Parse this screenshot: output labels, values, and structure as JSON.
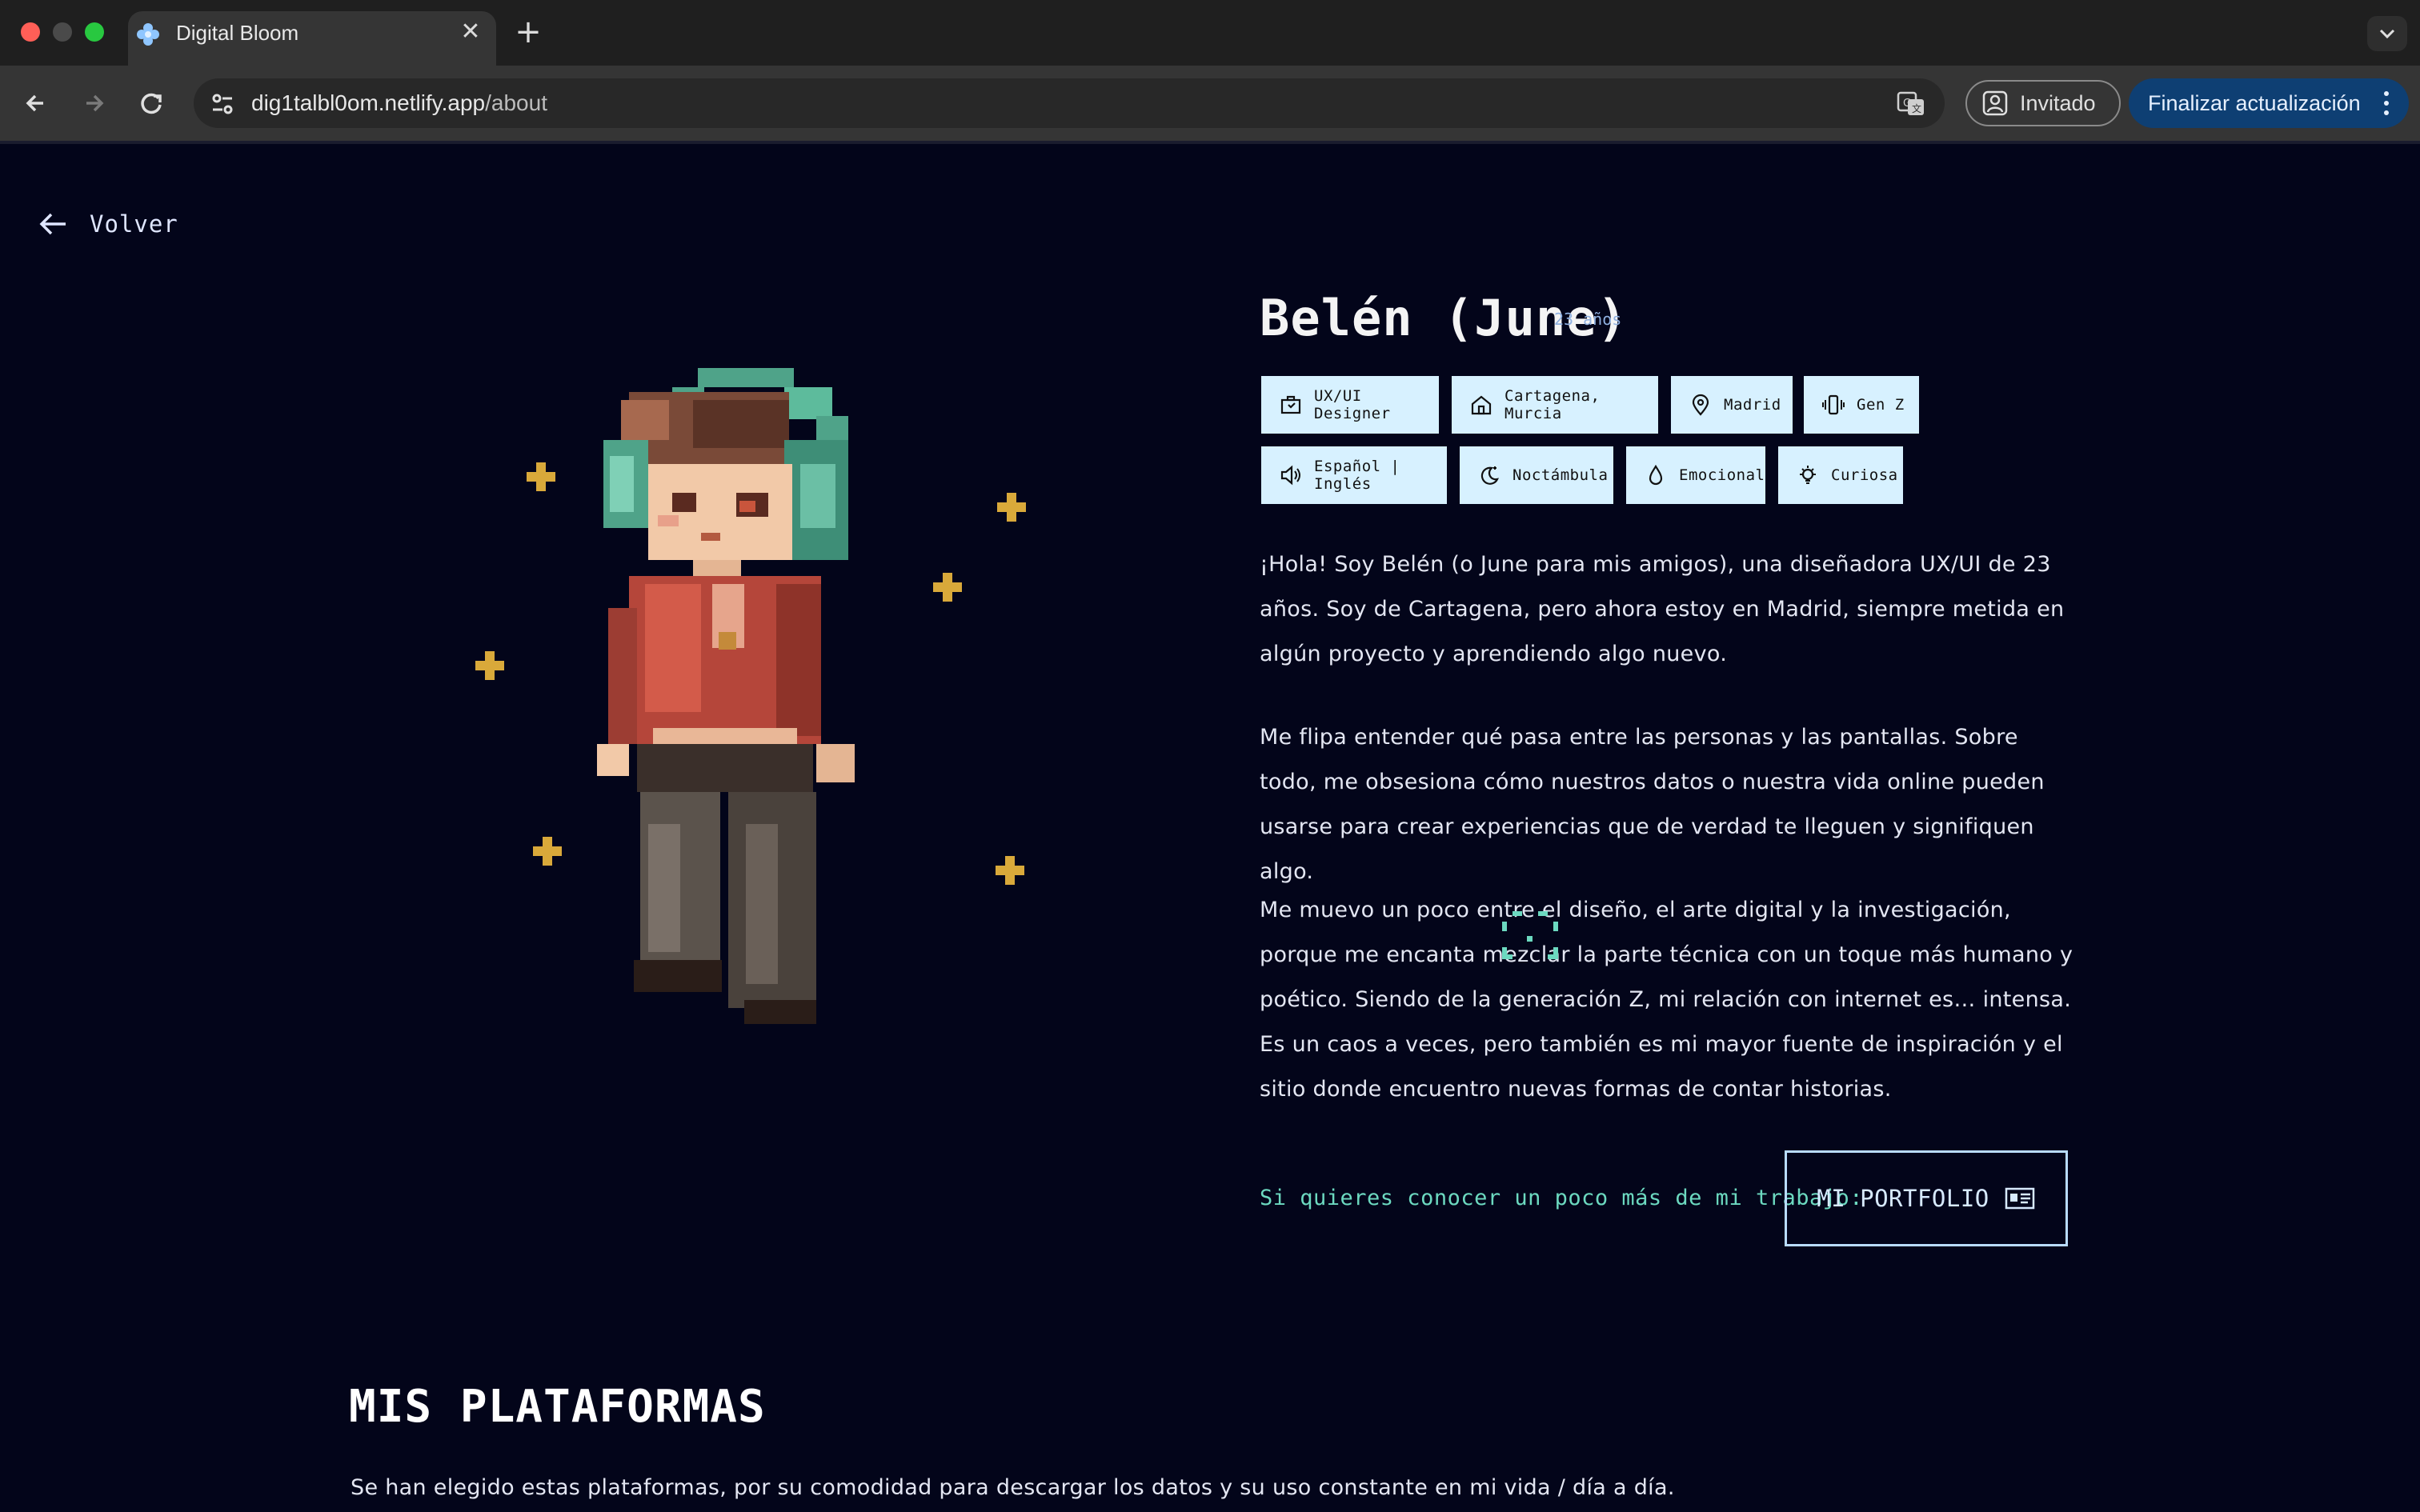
{
  "browser": {
    "tab_title": "Digital Bloom",
    "url_domain": "dig1talbl0om.netlify.app",
    "url_path": "/about",
    "guest_label": "Invitado",
    "update_label": "Finalizar actualización"
  },
  "page": {
    "back_label": "Volver",
    "name": "Belén (June)",
    "age": "23 años",
    "tags": [
      {
        "label": "UX/UI Designer",
        "icon": "briefcase-icon"
      },
      {
        "label": "Cartagena, Murcia",
        "icon": "home-icon"
      },
      {
        "label": "Madrid",
        "icon": "map-pin-icon"
      },
      {
        "label": "Gen Z",
        "icon": "phone-vibrate-icon"
      },
      {
        "label": "Español | Inglés",
        "icon": "speaker-icon"
      },
      {
        "label": "Noctámbula",
        "icon": "moon-stars-icon"
      },
      {
        "label": "Emocional",
        "icon": "droplet-icon"
      },
      {
        "label": "Curiosa",
        "icon": "lightbulb-icon"
      }
    ],
    "paragraphs": [
      "¡Hola! Soy Belén (o June para mis amigos), una diseñadora UX/UI de 23 años. Soy de Cartagena, pero ahora estoy en Madrid, siempre metida en algún proyecto y aprendiendo algo nuevo.",
      "Me flipa entender qué pasa entre las personas y las pantallas. Sobre todo, me obsesiona cómo nuestros datos o nuestra vida online pueden usarse para crear experiencias que de verdad te lleguen y signifiquen algo.",
      "Me muevo un poco entre el diseño, el arte digital y la investigación, porque me encanta mezclar la parte técnica con un toque más humano y poético. Siendo de la generación Z, mi relación con internet es… intensa. Es un caos a veces, pero también es mi mayor fuente de inspiración y el sitio donde encuentro nuevas formas de contar historias."
    ],
    "cta_text": "Si quieres conocer un poco más de mi trabajo:",
    "portfolio_label": "MI PORTFOLIO",
    "section_title": "MIS PLATAFORMAS",
    "section_desc": "Se han elegido estas plataformas, por su comodidad para descargar los datos y su uso constante en mi vida / día a día."
  },
  "colors": {
    "background": "#03051a",
    "tag_bg": "#d7f1ff",
    "accent_teal": "#6cd9c0",
    "sparkle": "#d9a93a"
  }
}
